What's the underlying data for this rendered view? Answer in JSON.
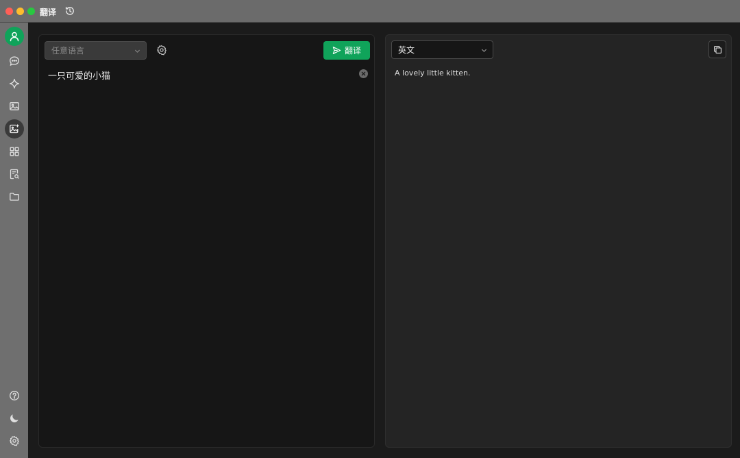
{
  "window": {
    "title": "翻译"
  },
  "sidebar": {
    "items": [
      {
        "icon": "user-avatar-icon"
      },
      {
        "icon": "chat-bubble-icon"
      },
      {
        "icon": "sparkle-icon"
      },
      {
        "icon": "image-icon"
      },
      {
        "icon": "image-add-icon",
        "active": true
      },
      {
        "icon": "grid-apps-icon"
      },
      {
        "icon": "document-search-icon"
      },
      {
        "icon": "folder-icon"
      }
    ],
    "bottom": [
      {
        "icon": "help-icon"
      },
      {
        "icon": "moon-theme-icon"
      },
      {
        "icon": "settings-gear-icon"
      }
    ]
  },
  "source": {
    "language_placeholder": "任意语言",
    "text": "一只可爱的小猫"
  },
  "toolbar": {
    "translate_label": "翻译"
  },
  "target": {
    "language": "英文",
    "result": "A lovely little kitten."
  },
  "colors": {
    "accent": "#10a35a",
    "titlebar": "#6b6b6b",
    "sidebar": "#6f6f6f"
  }
}
